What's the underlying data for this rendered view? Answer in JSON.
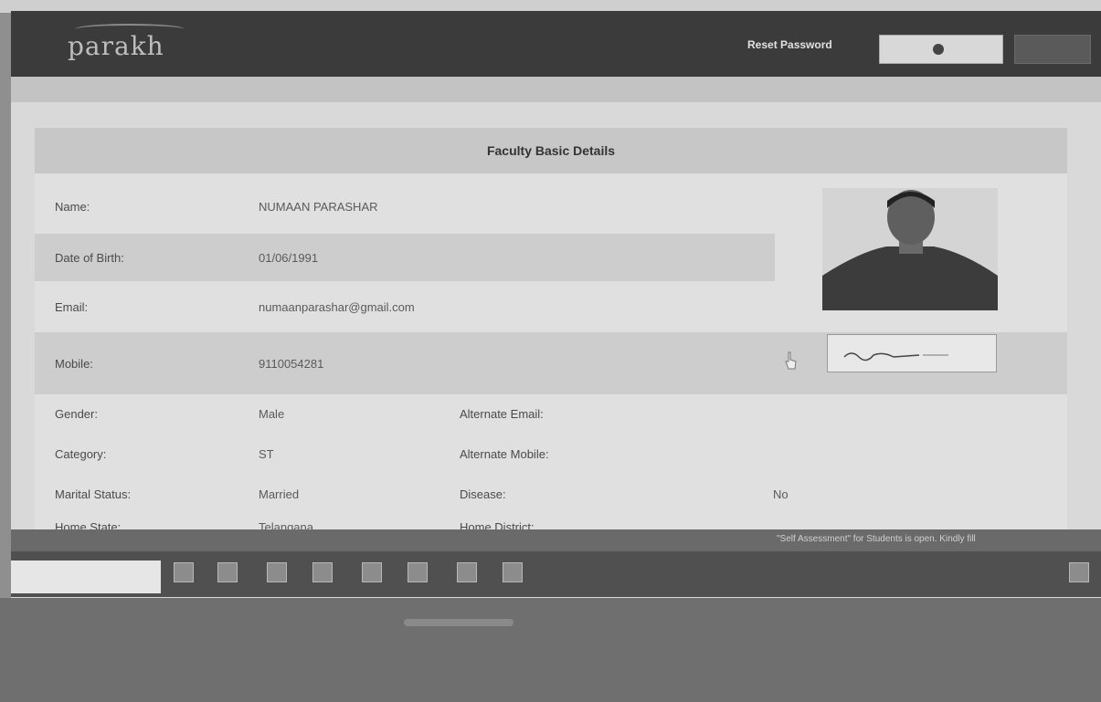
{
  "header": {
    "logo_text": "parakh",
    "reset_password_label": "Reset Password",
    "user_button_label": "",
    "logout_label": ""
  },
  "panel": {
    "title": "Faculty Basic Details"
  },
  "fields": [
    {
      "label": "Name:",
      "value": "NUMAAN PARASHAR"
    },
    {
      "label": "Date of Birth:",
      "value": "01/06/1991"
    },
    {
      "label": "Email:",
      "value": "numaanparashar@gmail.com"
    },
    {
      "label": "Mobile:",
      "value": "9110054281"
    }
  ],
  "pairs": [
    {
      "label": "Gender:",
      "value": "Male",
      "label2": "Alternate Email:",
      "value2": ""
    },
    {
      "label": "Category:",
      "value": "ST",
      "label2": "Alternate Mobile:",
      "value2": ""
    },
    {
      "label": "Marital Status:",
      "value": "Married",
      "label2": "Disease:",
      "value2": "No"
    },
    {
      "label": "Home State:",
      "value": "Telangana",
      "label2": "Home District:",
      "value2": ""
    }
  ],
  "notice_text": "\"Self Assessment\" for Students is open. Kindly fill",
  "taskbar": {
    "clock": "",
    "date": ""
  },
  "colors": {
    "header_bg": "#3b3b3b",
    "panel_bg": "#e0e0e0",
    "title_bg": "#c7c7c7"
  }
}
